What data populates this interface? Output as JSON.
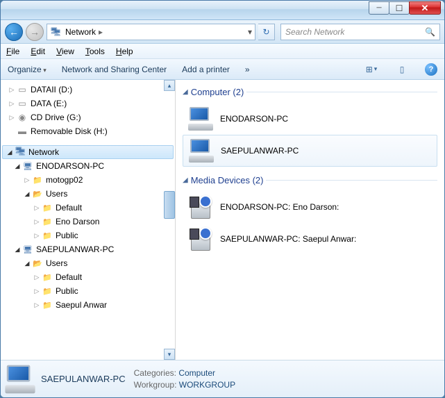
{
  "address": {
    "location": "Network"
  },
  "search": {
    "placeholder": "Search Network"
  },
  "menu": {
    "file": "File",
    "edit": "Edit",
    "view": "View",
    "tools": "Tools",
    "help": "Help"
  },
  "toolbar": {
    "organize": "Organize",
    "netcenter": "Network and Sharing Center",
    "addprinter": "Add a printer"
  },
  "tree": {
    "drives": [
      {
        "label": "DATAII (D:)",
        "type": "drive"
      },
      {
        "label": "DATA (E:)",
        "type": "drive"
      },
      {
        "label": "CD Drive (G:)",
        "type": "cd"
      },
      {
        "label": "Removable Disk (H:)",
        "type": "removable"
      }
    ],
    "network_label": "Network",
    "pc1": {
      "name": "ENODARSON-PC",
      "shares": [
        "motogp02"
      ],
      "users_label": "Users",
      "users": [
        "Default",
        "Eno Darson",
        "Public"
      ]
    },
    "pc2": {
      "name": "SAEPULANWAR-PC",
      "users_label": "Users",
      "users": [
        "Default",
        "Public",
        "Saepul Anwar"
      ]
    }
  },
  "main": {
    "group1": {
      "title": "Computer (2)",
      "items": [
        "ENODARSON-PC",
        "SAEPULANWAR-PC"
      ]
    },
    "group2": {
      "title": "Media Devices (2)",
      "items": [
        "ENODARSON-PC: Eno Darson:",
        "SAEPULANWAR-PC: Saepul Anwar:"
      ]
    }
  },
  "details": {
    "name": "SAEPULANWAR-PC",
    "cat_label": "Categories:",
    "cat_value": "Computer",
    "wg_label": "Workgroup:",
    "wg_value": "WORKGROUP"
  }
}
